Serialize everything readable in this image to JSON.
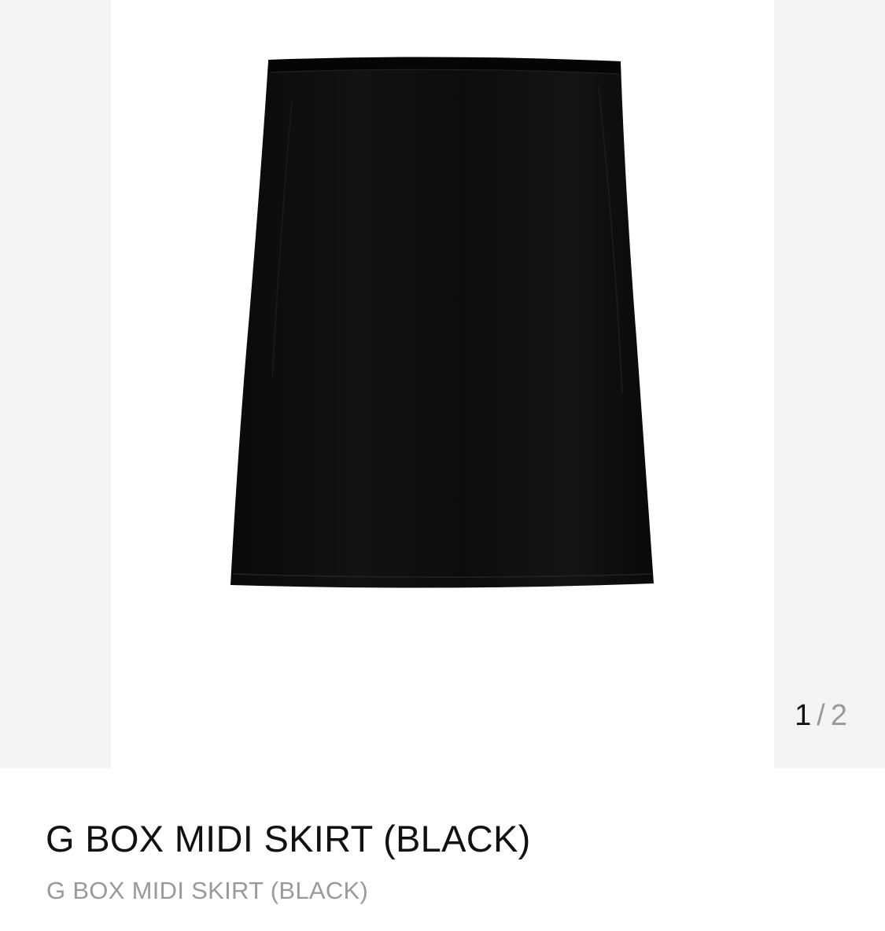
{
  "product": {
    "title": "G BOX MIDI SKIRT (BLACK)",
    "subtitle": "G BOX MIDI SKIRT (BLACK)",
    "image": {
      "alt": "Black midi skirt product photo",
      "garment_color": "#0d0d0d"
    }
  },
  "gallery": {
    "current": "1",
    "separator": "/",
    "total": "2",
    "background": "#f4f4f4"
  }
}
